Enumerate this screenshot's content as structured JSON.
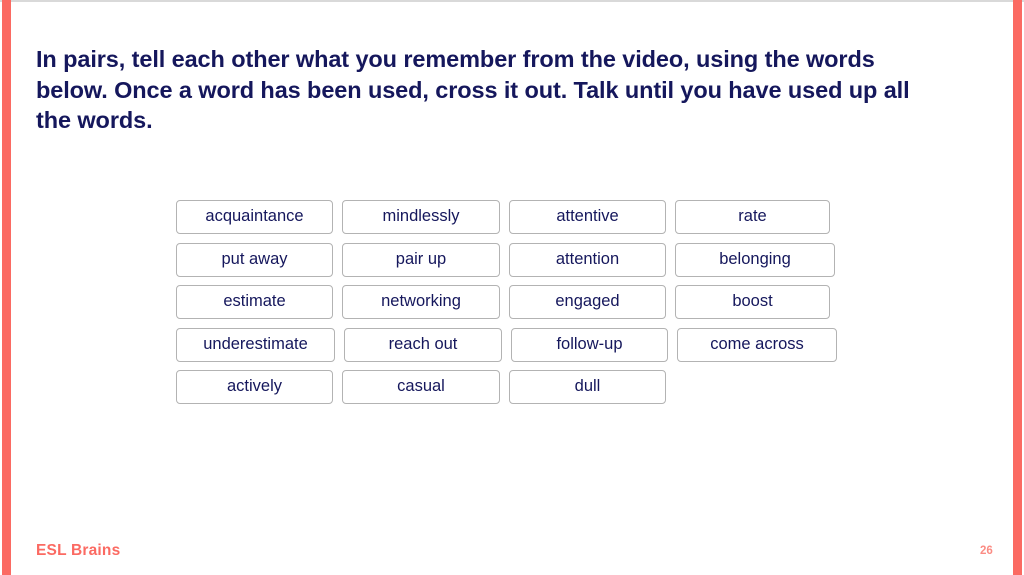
{
  "slide": {
    "heading": "In pairs, tell each other what you remember from the video, using the words below. Once a word has been used, cross it out. Talk until you have used up all the words.",
    "accent_color": "#fb6a62",
    "text_color": "#15175c",
    "card_border_color": "#b3b3b3",
    "background_color": "#ffffff"
  },
  "word_grid": {
    "rows": [
      [
        {
          "label": "acquaintance"
        },
        {
          "label": "mindlessly"
        },
        {
          "label": "attentive"
        },
        {
          "label": "rate"
        }
      ],
      [
        {
          "label": "put away"
        },
        {
          "label": "pair up"
        },
        {
          "label": "attention"
        },
        {
          "label": "belonging"
        }
      ],
      [
        {
          "label": "estimate"
        },
        {
          "label": "networking"
        },
        {
          "label": "engaged"
        },
        {
          "label": "boost"
        }
      ],
      [
        {
          "label": "underestimate"
        },
        {
          "label": "reach out"
        },
        {
          "label": "follow-up"
        },
        {
          "label": "come across"
        }
      ],
      [
        {
          "label": "actively"
        },
        {
          "label": "casual"
        },
        {
          "label": "dull"
        }
      ]
    ]
  },
  "footer": {
    "logo": "ESL Brains",
    "page_number": "26"
  }
}
